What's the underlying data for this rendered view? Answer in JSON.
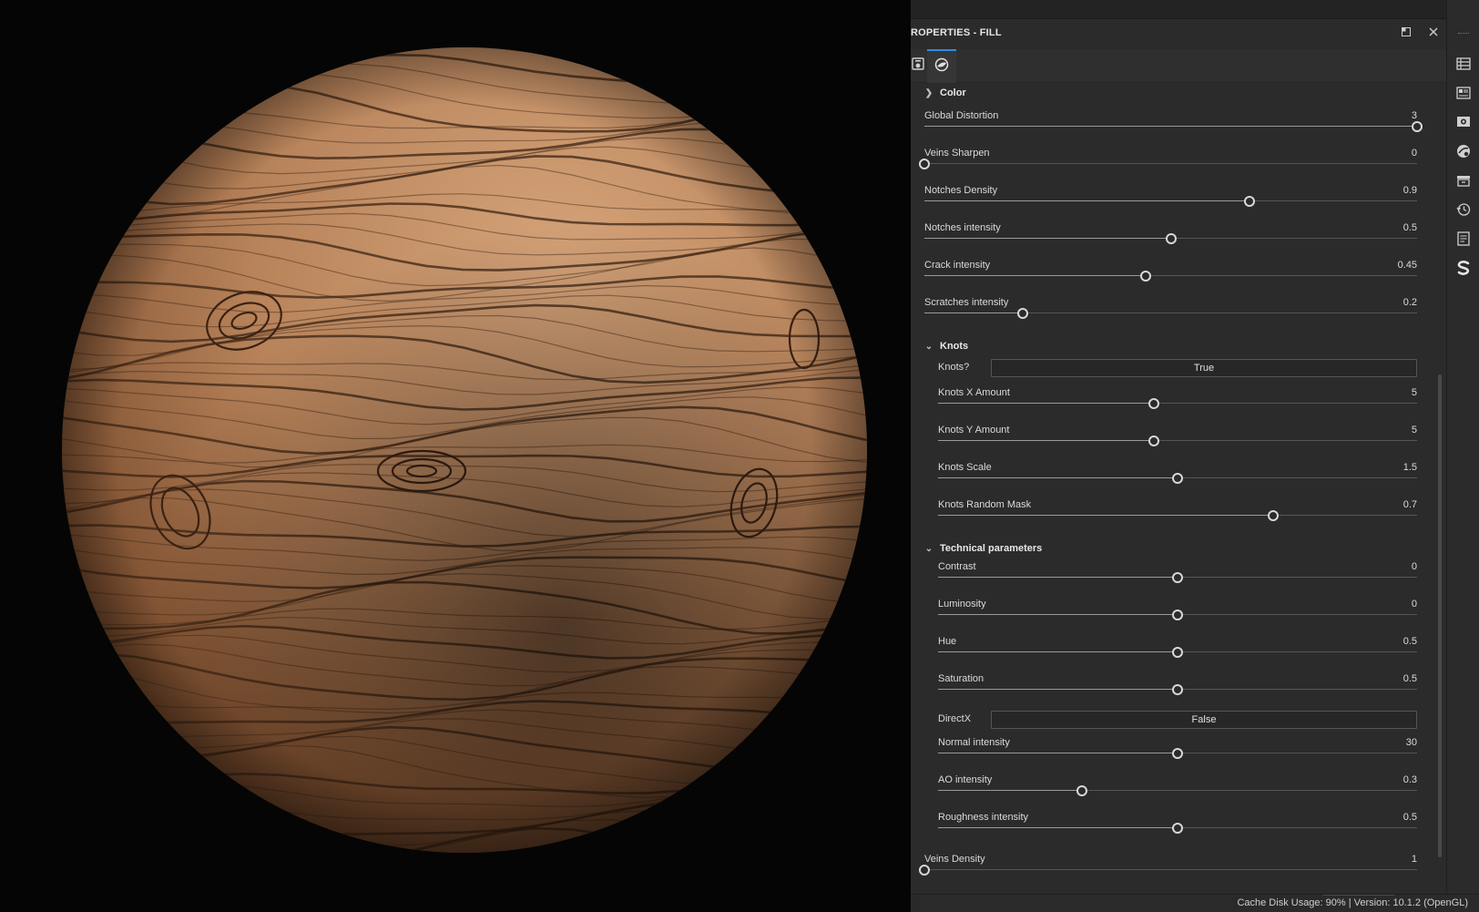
{
  "panel": {
    "title": "ROPERTIES - FILL",
    "tabs": [
      {
        "icon": "texture-tab-icon",
        "active": false
      },
      {
        "icon": "material-sphere-tab-icon",
        "active": true
      }
    ]
  },
  "sections": {
    "color": {
      "label": "Color",
      "expanded": false
    },
    "knots": {
      "label": "Knots",
      "expanded": true
    },
    "technical": {
      "label": "Technical parameters",
      "expanded": true
    }
  },
  "params": {
    "global_distortion": {
      "label": "Global Distortion",
      "value": "3",
      "fraction": 1.0
    },
    "veins_sharpen": {
      "label": "Veins Sharpen",
      "value": "0",
      "fraction": 0.0
    },
    "notches_density": {
      "label": "Notches Density",
      "value": "0.9",
      "fraction": 0.66
    },
    "notches_intensity": {
      "label": "Notches intensity",
      "value": "0.5",
      "fraction": 0.5
    },
    "crack_intensity": {
      "label": "Crack intensity",
      "value": "0.45",
      "fraction": 0.45
    },
    "scratches_intensity": {
      "label": "Scratches intensity",
      "value": "0.2",
      "fraction": 0.2
    },
    "knots_toggle": {
      "label": "Knots?",
      "value": "True"
    },
    "knots_x_amount": {
      "label": "Knots X Amount",
      "value": "5",
      "fraction": 0.45
    },
    "knots_y_amount": {
      "label": "Knots Y Amount",
      "value": "5",
      "fraction": 0.45
    },
    "knots_scale": {
      "label": "Knots Scale",
      "value": "1.5",
      "fraction": 0.5
    },
    "knots_random_mask": {
      "label": "Knots Random Mask",
      "value": "0.7",
      "fraction": 0.7
    },
    "contrast": {
      "label": "Contrast",
      "value": "0",
      "fraction": 0.5
    },
    "luminosity": {
      "label": "Luminosity",
      "value": "0",
      "fraction": 0.5
    },
    "hue": {
      "label": "Hue",
      "value": "0.5",
      "fraction": 0.5
    },
    "saturation": {
      "label": "Saturation",
      "value": "0.5",
      "fraction": 0.5
    },
    "directx": {
      "label": "DirectX",
      "value": "False"
    },
    "normal_intensity": {
      "label": "Normal intensity",
      "value": "30",
      "fraction": 0.5
    },
    "ao_intensity": {
      "label": "AO intensity",
      "value": "0.3",
      "fraction": 0.3
    },
    "roughness_intensity": {
      "label": "Roughness intensity",
      "value": "0.5",
      "fraction": 0.5
    },
    "veins_density": {
      "label": "Veins Density",
      "value": "1",
      "fraction": 0.0
    }
  },
  "status": {
    "text": "Cache Disk Usage:   90% | Version: 10.1.2 (OpenGL)"
  },
  "right_toolbar": [
    "layers-icon",
    "texture-set-list-icon",
    "display-settings-icon",
    "shader-settings-icon",
    "bake-icon",
    "history-icon",
    "log-icon",
    "substance-logo-icon"
  ],
  "colors": {
    "accent": "#2f8be6",
    "panel_bg": "#2b2b2b",
    "viewport_bg": "#050505",
    "wood_light": "#c08a5e",
    "wood_dark": "#3a2414"
  }
}
